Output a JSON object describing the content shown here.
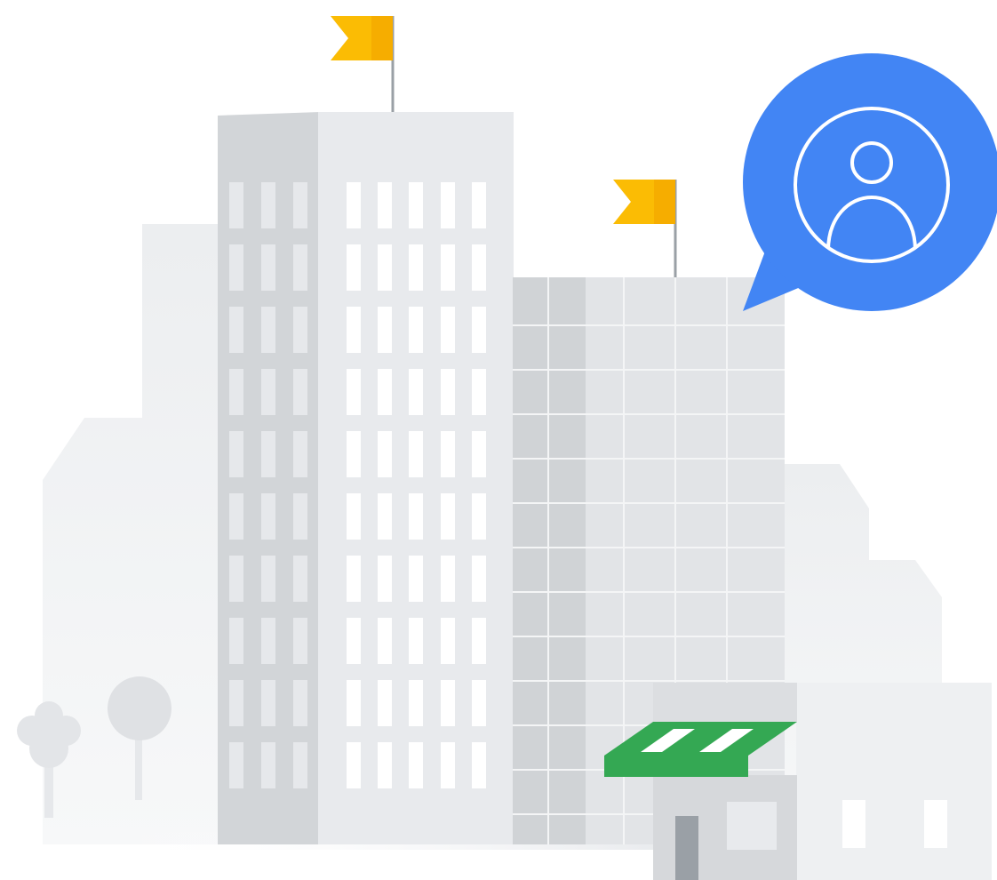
{
  "illustration": {
    "subject": "city-buildings-with-profile-bubble",
    "icons": {
      "profile": "account-circle-icon",
      "flag": "flag-icon",
      "tree": "tree-icon"
    },
    "palette": {
      "background": "#ffffff",
      "bg_building": "#f1f3f4",
      "tower_shadow": "#d2d5d8",
      "tower_face": "#e8eaed",
      "tower_window": "#ffffff",
      "glass_building": "#e2e4e7",
      "glass_shadow": "#d0d3d6",
      "flag": "#fbbc04",
      "flagpole": "#9aa0a6",
      "bubble": "#4285f4",
      "bubble_icon_stroke": "#ffffff",
      "awning_green": "#34a853",
      "awning_stripe": "#ffffff",
      "shop_body": "#d6d8db",
      "shop_door": "#9aa0a6",
      "annex": "#eef0f2",
      "tree": "#e3e5e8"
    }
  }
}
